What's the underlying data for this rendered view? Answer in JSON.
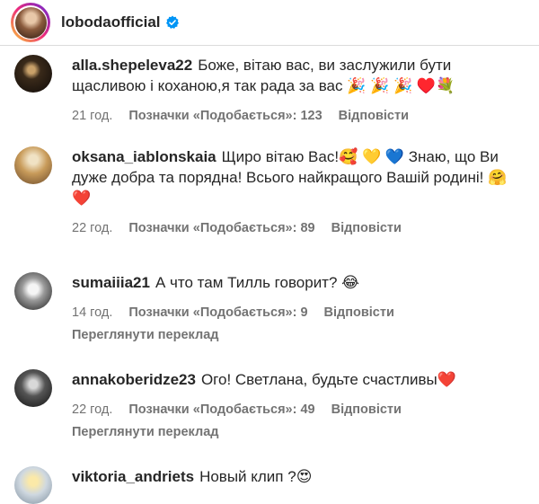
{
  "header": {
    "username": "lobodaofficial"
  },
  "labels": {
    "likes_prefix": "Позначки «Подобається»: ",
    "reply": "Відповісти",
    "translate": "Переглянути переклад"
  },
  "comments": [
    {
      "username": "alla.shepeleva22",
      "text": "Боже, вітаю вас, ви заслужили бути щасливою і коханою,я так рада за вас 🎉 🎉 🎉 ♥️💐",
      "time": "21 год.",
      "likes": "Позначки «Подобається»: 123",
      "reply": "Відповісти"
    },
    {
      "username": "oksana_iablonskaia",
      "text": "Щиро вітаю Вас!🥰 💛 💙 Знаю, що Ви дуже добра та порядна! Всього найкращого Вашій родині! 🤗 ❤️",
      "time": "22 год.",
      "likes": "Позначки «Подобається»: 89",
      "reply": "Відповісти"
    },
    {
      "username": "sumaiiia21",
      "text": "А что там Тилль говорит? 😂",
      "time": "14 год.",
      "likes": "Позначки «Подобається»: 9",
      "reply": "Відповісти",
      "translate": "Переглянути переклад"
    },
    {
      "username": "annakoberidze23",
      "text": "Ого! Светлана, будьте счастливы❤️",
      "time": "22 год.",
      "likes": "Позначки «Подобається»: 49",
      "reply": "Відповісти",
      "translate": "Переглянути переклад"
    },
    {
      "username": "viktoria_andriets",
      "text": "Новый клип ?😍"
    }
  ],
  "colors": {
    "verified": "#0095f6",
    "meta": "#737373",
    "text": "#262626"
  },
  "icons": {
    "verified": "verified-badge-icon"
  }
}
